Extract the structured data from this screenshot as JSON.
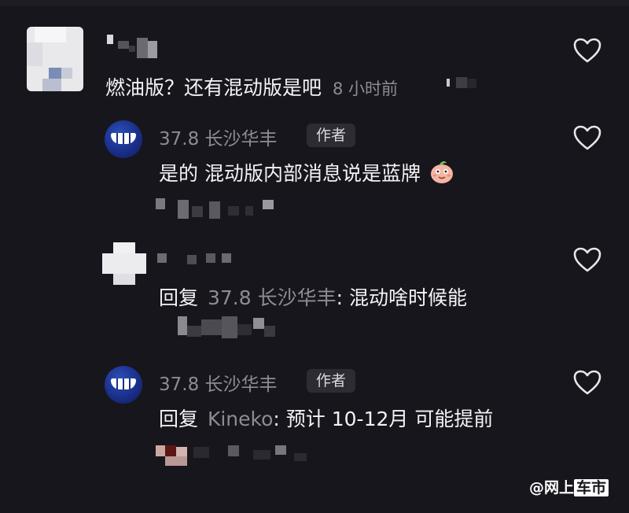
{
  "comments": [
    {
      "username": "",
      "text": "燃油版？还有混动版是吧",
      "time": "8 小时前"
    },
    {
      "username": "37.8 长沙华丰",
      "badge": "作者",
      "text": "是的 混动版内部消息说是蓝牌"
    },
    {
      "username": "",
      "reply_prefix": "回复",
      "reply_target": "37.8 长沙华丰",
      "text": ": 混动啥时候能"
    },
    {
      "username": "37.8 长沙华丰",
      "badge": "作者",
      "reply_prefix": "回复",
      "reply_target": "Kineko",
      "text": ": 预计 10-12月 可能提前"
    }
  ],
  "watermark": {
    "at": "@",
    "part1": "网上",
    "part2": "车市"
  },
  "icons": {
    "like": "heart-outline-icon",
    "emoji": "peach-face-emoji-icon"
  },
  "colors": {
    "background": "#17161c",
    "text": "#f3f3f5",
    "muted": "#8d8c93",
    "badge_bg": "#2d2c33",
    "brand_avatar": "#1a2f8a"
  }
}
